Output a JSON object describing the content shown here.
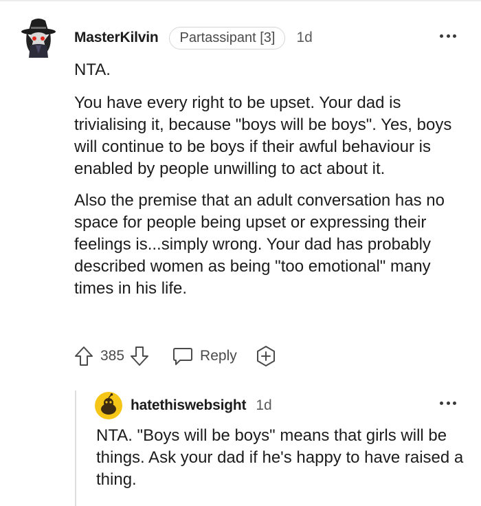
{
  "comment": {
    "username": "MasterKilvin",
    "flair": "Partassipant [3]",
    "age": "1d",
    "paragraphs": [
      "NTA.",
      "You have every right to be upset. Your dad is trivialising it, because \"boys will be boys\". Yes, boys will continue to be boys if their awful behaviour is enabled by people unwilling to act about it.",
      "Also the premise that an adult conversation has no space for people being upset or expressing their feelings is...simply wrong. Your dad has probably described women as being \"too emotional\" many times in his life."
    ],
    "score": "385",
    "reply_label": "Reply",
    "icons": {
      "avatar": "snoo-avatar-witch-hat",
      "more": "more-dots-icon",
      "upvote": "arrow-up-icon",
      "downvote": "arrow-down-icon",
      "reply": "speech-bubble-icon",
      "award": "award-plus-icon"
    }
  },
  "reply": {
    "username": "hatethiswebsight",
    "age": "1d",
    "text": "NTA. \"Boys will be boys\" means that girls will be things. Ask your dad if he's happy to have raised a thing.",
    "avatar_color": "#f5c518"
  },
  "colors": {
    "text": "#1c1c1c",
    "meta": "#5b5b5b",
    "thread_line": "#dedede"
  }
}
